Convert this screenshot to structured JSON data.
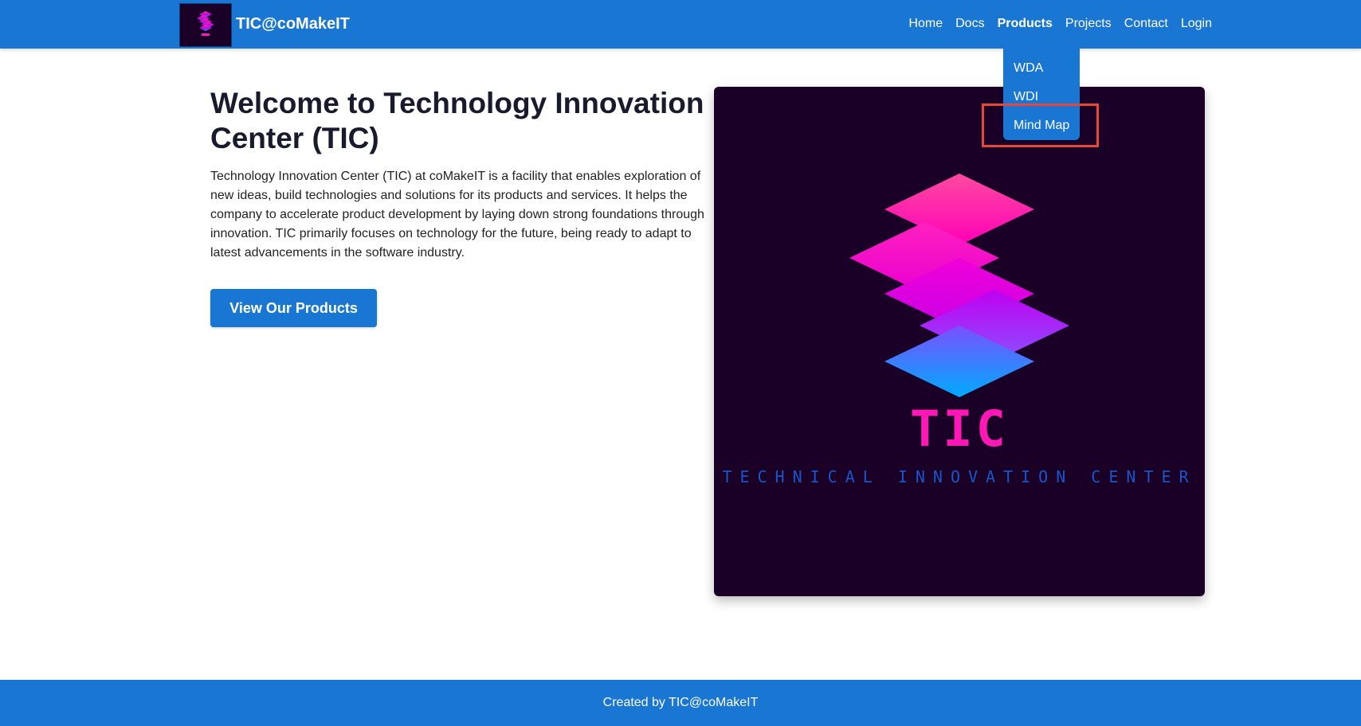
{
  "header": {
    "brand": "TIC@coMakeIT",
    "nav": [
      {
        "label": "Home"
      },
      {
        "label": "Docs"
      },
      {
        "label": "Products"
      },
      {
        "label": "Projects"
      },
      {
        "label": "Contact"
      },
      {
        "label": "Login"
      }
    ],
    "active": "Products"
  },
  "products_dropdown": {
    "items": [
      {
        "label": "WDA"
      },
      {
        "label": "WDI"
      },
      {
        "label": "Mind Map"
      }
    ],
    "highlighted": "Mind Map"
  },
  "hero": {
    "title": "Welcome to Technology Innovation Center (TIC)",
    "description": "Technology Innovation Center (TIC) at coMakeIT is a facility that enables exploration of new ideas, build technologies and solutions for its products and services. It helps the company to accelerate product development by laying down strong foundations through innovation. TIC primarily focuses on technology for the future, being ready to adapt to latest advancements in the software industry.",
    "cta_label": "View Our Products",
    "image": {
      "wordmark": "TIC",
      "tagline": "TECHNICAL INNOVATION CENTER"
    }
  },
  "footer": {
    "text": "Created by TIC@coMakeIT"
  },
  "colors": {
    "primary": "#1976d2",
    "highlight": "#e8473c",
    "logo_bg": "#1a0026",
    "logo_pink": "#ff18b6",
    "logo_blue": "#1a56c9"
  }
}
